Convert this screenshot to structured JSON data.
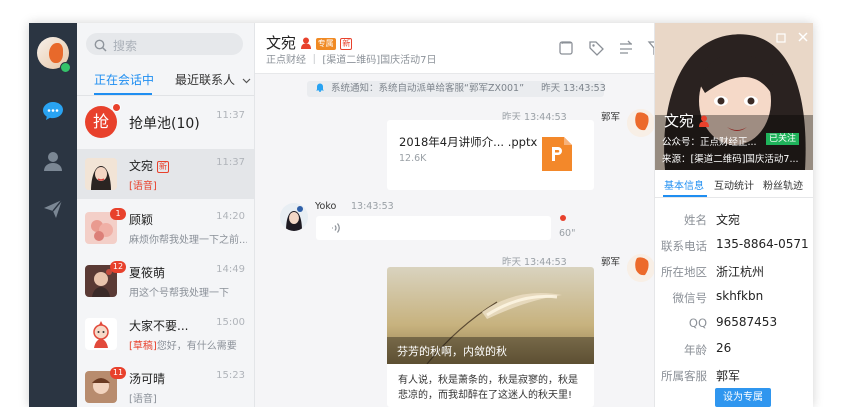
{
  "search": {
    "placeholder": "搜索"
  },
  "tabs": {
    "active": "正在会话中",
    "recent": "最近联系人"
  },
  "conversations": [
    {
      "name": "抢单池(10)",
      "time": "11:37",
      "avatar_char": "抢"
    },
    {
      "name": "文宛",
      "time": "11:37",
      "preview": "[语音]",
      "tag": "新"
    },
    {
      "name": "顾颖",
      "time": "14:20",
      "preview": "麻烦你帮我处理一下之前...",
      "badge": "1"
    },
    {
      "name": "夏筱萌",
      "time": "14:49",
      "preview": "用这个号帮我处理一下",
      "badge": "12"
    },
    {
      "name": "大家不要...",
      "time": "15:00",
      "preview_tag": "[草稿]",
      "preview": "您好，有什么需要"
    },
    {
      "name": "汤可晴",
      "time": "15:23",
      "preview": "[语音]",
      "badge": "11"
    }
  ],
  "chat": {
    "title": "文宛",
    "title_tags": [
      "专属",
      "新"
    ],
    "subtitle": "正点财经 ｜ [渠道二维码]国庆活动7日",
    "system": {
      "label": "系统通知：系统自动派单给客服“郭军ZX001”",
      "time": "昨天 13:43:53"
    },
    "messages": [
      {
        "meta": "昨天 13:44:53",
        "sender": "郭军",
        "file_name": "2018年4月讲师介... .pptx",
        "file_size": "12.6K"
      },
      {
        "sender": "Yoko",
        "time": "13:43:53",
        "duration": "60\""
      },
      {
        "meta": "昨天 13:44:53",
        "sender": "郭军",
        "card_title": "芬芳的秋啊，内敛的秋",
        "card_text": "有人说，秋是萧条的，秋是寂寥的，秋是悲凉的，而我却醉在了这迷人的秋天里!"
      }
    ]
  },
  "profile": {
    "name": "文宛",
    "public": "公众号：正点财经正...",
    "followed": "已关注",
    "source": "来源：[渠道二维码]国庆活动7...",
    "tabs": [
      "基本信息",
      "互动统计",
      "粉丝轨迹"
    ],
    "fields": [
      {
        "label": "姓名",
        "value": "文宛"
      },
      {
        "label": "联系电话",
        "value": "135-8864-0571"
      },
      {
        "label": "所在地区",
        "value": "浙江杭州"
      },
      {
        "label": "微信号",
        "value": "skhfkbn"
      },
      {
        "label": "QQ",
        "value": "96587453"
      },
      {
        "label": "年龄",
        "value": "26"
      },
      {
        "label": "所属客服",
        "value": "郭军"
      }
    ],
    "button": "设为专属"
  }
}
